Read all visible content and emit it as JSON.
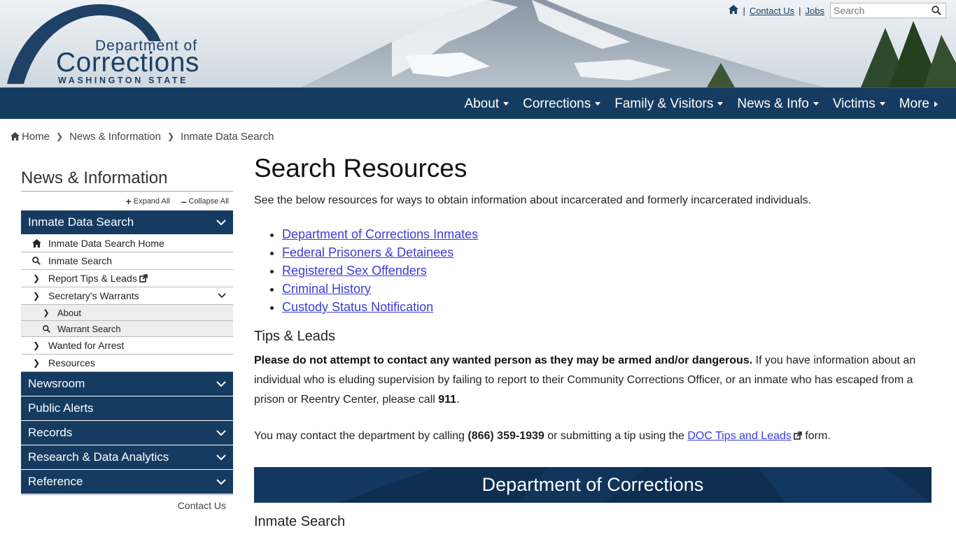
{
  "logo": {
    "line1": "Department of",
    "line2": "Corrections",
    "line3": "WASHINGTON STATE"
  },
  "utility": {
    "contact_label": "Contact Us",
    "jobs_label": "Jobs",
    "search_placeholder": "Search"
  },
  "nav": {
    "items": [
      "About",
      "Corrections",
      "Family & Visitors",
      "News & Info",
      "Victims",
      "More"
    ]
  },
  "breadcrumb": {
    "home": "Home",
    "level2": "News & Information",
    "level3": "Inmate Data Search"
  },
  "sidebar": {
    "title": "News & Information",
    "expand_all": "Expand All",
    "collapse_all": "Collapse All",
    "section_active": "Inmate Data Search",
    "items": [
      "Inmate Data Search Home",
      "Inmate Search",
      "Report Tips & Leads",
      "Secretary's Warrants",
      "Wanted for Arrest",
      "Resources"
    ],
    "sub_items": [
      "About",
      "Warrant Search"
    ],
    "sections": [
      "Newsroom",
      "Public Alerts",
      "Records",
      "Research & Data Analytics",
      "Reference"
    ],
    "contact": "Contact Us"
  },
  "main": {
    "title": "Search Resources",
    "intro": "See the below resources for ways to obtain information about incarcerated and formerly incarcerated individuals.",
    "links": [
      "Department of Corrections Inmates",
      "Federal Prisoners & Detainees",
      "Registered Sex Offenders",
      "Criminal History",
      "Custody Status Notification"
    ],
    "tips_heading": "Tips & Leads",
    "tips_bold": "Please do not attempt to contact any wanted person as they may be armed and/or dangerous.",
    "tips_text": " If you have information about an individual who is eluding supervision by failing to report to their Community Corrections Officer, or an inmate who has escaped from a prison or Reentry Center, please call ",
    "tips_phone": "911",
    "tips_end": ".",
    "contact_text1": "You may contact the department by calling ",
    "contact_phone": "(866) 359-1939",
    "contact_text2": " or submitting a tip using the ",
    "contact_link": "DOC Tips and Leads",
    "contact_text3": " form.",
    "banner": "Department of Corrections",
    "inmate_heading": "Inmate Search"
  },
  "colors": {
    "navy": "#153b61",
    "link": "#3c3cd8",
    "banner": "#0e2f52"
  }
}
